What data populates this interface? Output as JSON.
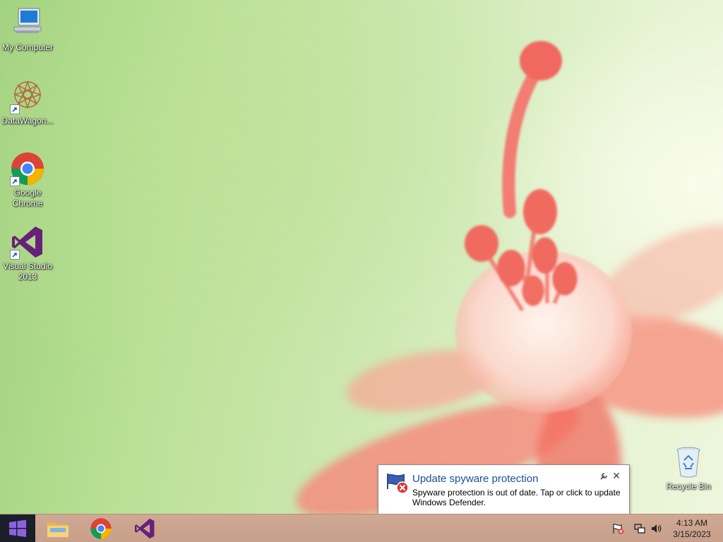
{
  "desktop": {
    "icons": [
      {
        "label": "My Computer",
        "icon": "computer-icon"
      },
      {
        "label": "DataWagon...",
        "icon": "datawagon-icon"
      },
      {
        "label": "Google\nChrome",
        "icon": "chrome-icon"
      },
      {
        "label": "Visual Studio\n2013",
        "icon": "visual-studio-icon"
      },
      {
        "label": "Recycle Bin",
        "icon": "recycle-bin-icon"
      }
    ]
  },
  "notification": {
    "title": "Update spyware protection",
    "message": "Spyware protection is out of date. Tap or click to update Windows Defender.",
    "icon": "windows-defender-alert-icon",
    "close": "✕"
  },
  "taskbar": {
    "start_icon": "windows-logo-icon",
    "apps": [
      "file-explorer-icon",
      "chrome-icon",
      "visual-studio-icon"
    ],
    "tray": [
      "action-center-alert-icon",
      "network-icon",
      "volume-icon"
    ],
    "clock": {
      "time": "4:13 AM",
      "date": "3/15/2023"
    }
  },
  "colors": {
    "taskbar": "#cfa994",
    "start_button": "#1b1f2a",
    "notification_title": "#1b4fa0",
    "visual_studio": "#68217a"
  }
}
